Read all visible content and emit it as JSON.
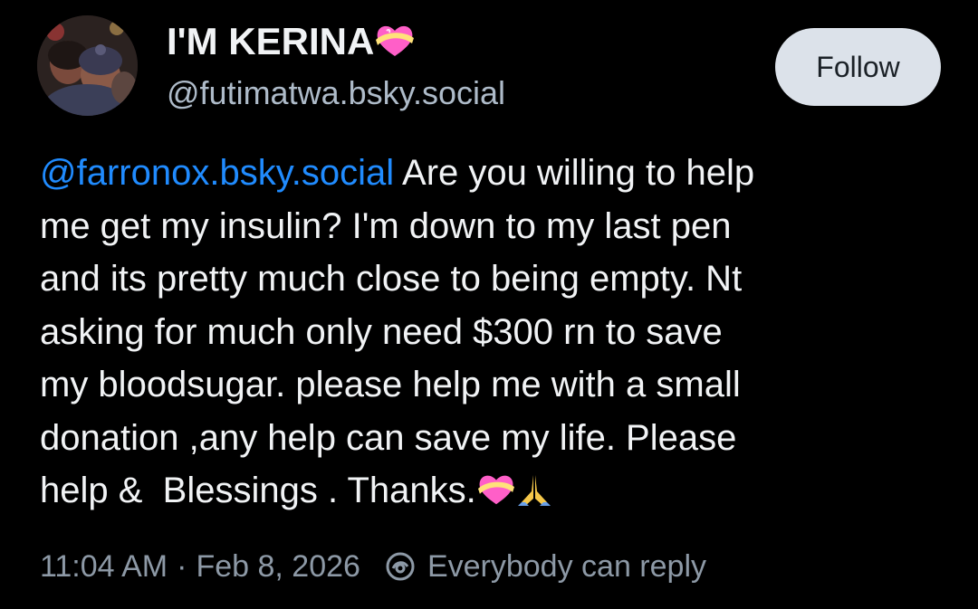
{
  "author": {
    "display_name": "I'M KERINA",
    "display_name_emoji": "heart-with-ribbon-emoji",
    "handle": "@futimatwa.bsky.social",
    "avatar": "profile-photo"
  },
  "follow_button": {
    "label": "Follow"
  },
  "post": {
    "mention": "@farronox.bsky.social",
    "line1_text": " Are you willing to help",
    "lines": [
      "me get my insulin? I'm down to my last pen",
      "and its pretty much close to being empty. Nt",
      "asking for much only need $300 rn to save",
      "my bloodsugar. please help me with a small",
      "donation ,any help can save my life. Please"
    ],
    "last_line": "help &  Blessings . Thanks.",
    "trailing_emojis": [
      "heart-with-ribbon-emoji",
      "folded-hands-emoji"
    ]
  },
  "meta": {
    "time": "11:04 AM",
    "separator": "·",
    "date": "Feb 8, 2026",
    "reply_icon": "reply-settings-icon",
    "reply_setting": "Everybody can reply"
  },
  "colors": {
    "background": "#000000",
    "text": "#f1f3f5",
    "handle": "#aebbc9",
    "mention": "#208bfe",
    "meta": "#8d99a6",
    "follow_bg": "#dce2ea"
  }
}
